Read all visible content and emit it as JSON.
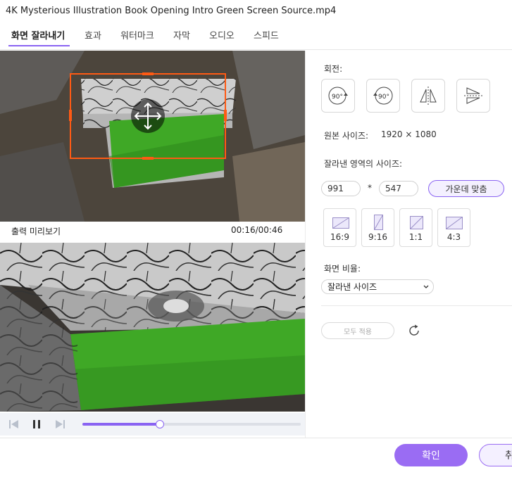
{
  "window": {
    "title": "4K Mysterious Illustration Book Opening Intro Green Screen Source.mp4"
  },
  "tabs": [
    {
      "label": "화면 잘라내기"
    },
    {
      "label": "효과"
    },
    {
      "label": "워터마크"
    },
    {
      "label": "자막"
    },
    {
      "label": "오디오"
    },
    {
      "label": "스피드"
    }
  ],
  "preview": {
    "label": "출력 미리보기",
    "time": "00:16/00:46"
  },
  "player": {
    "progress": 0.35
  },
  "crop": {
    "rotation_label": "회전:",
    "rotate_left_label": "90°",
    "rotate_right_label": "90°",
    "original_size_label": "원본 사이즈:",
    "original_size_value": "1920 × 1080",
    "crop_size_label": "잘라낸 영역의 사이즈:",
    "width": "991",
    "times": "*",
    "height": "547",
    "center_label": "가운데 맞춤",
    "ratios": [
      {
        "label": "16:9"
      },
      {
        "label": "9:16"
      },
      {
        "label": "1:1"
      },
      {
        "label": "4:3"
      }
    ],
    "aspect_label": "화면 비율:",
    "aspect_value": "잘라낸 사이즈",
    "apply_all_label": "모두 적용"
  },
  "footer": {
    "ok_label": "확인",
    "cancel_label": "취"
  },
  "colors": {
    "accent": "#8a63f2",
    "crop_frame": "#ff5a14",
    "green_screen": "#3fa826"
  }
}
